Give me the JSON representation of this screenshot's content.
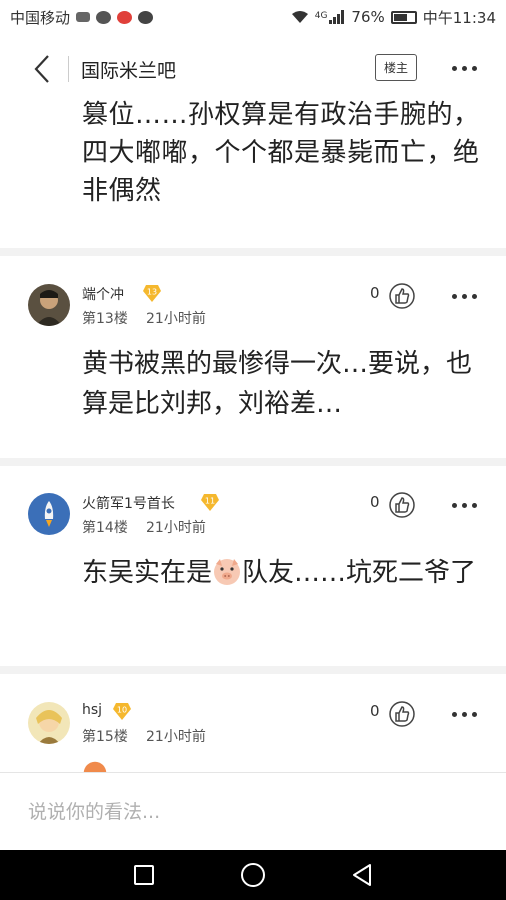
{
  "status_bar": {
    "carrier": "中国移动",
    "network": "4G",
    "battery": "76%",
    "battery_level": 0.76,
    "time": "中午11:34"
  },
  "header": {
    "forum_name": "国际米兰吧",
    "owner_badge": "楼主"
  },
  "partial_reply": {
    "text": "篡位……孙权算是有政治手腕的，四大嘟嘟，个个都是暴毙而亡，绝非偶然"
  },
  "posts": [
    {
      "username": "端个冲",
      "level": "13",
      "floor": "第13楼",
      "time": "21小时前",
      "likes": "0",
      "body": "黄书被黑的最惨得一次…要说，也算是比刘邦，刘裕差…"
    },
    {
      "username": "火箭军1号首长",
      "level": "11",
      "floor": "第14楼",
      "time": "21小时前",
      "likes": "0",
      "body_before": "东吴实在是",
      "body_after": "队友……坑死二爷了"
    },
    {
      "username": "hsj",
      "level": "10",
      "floor": "第15楼",
      "time": "21小时前",
      "likes": "0"
    }
  ],
  "comment_bar": {
    "placeholder": "说说你的看法..."
  },
  "colors": {
    "badge_gold": "#f5b82e",
    "separator": "#f2f2f2",
    "system_nav": "#000000"
  }
}
